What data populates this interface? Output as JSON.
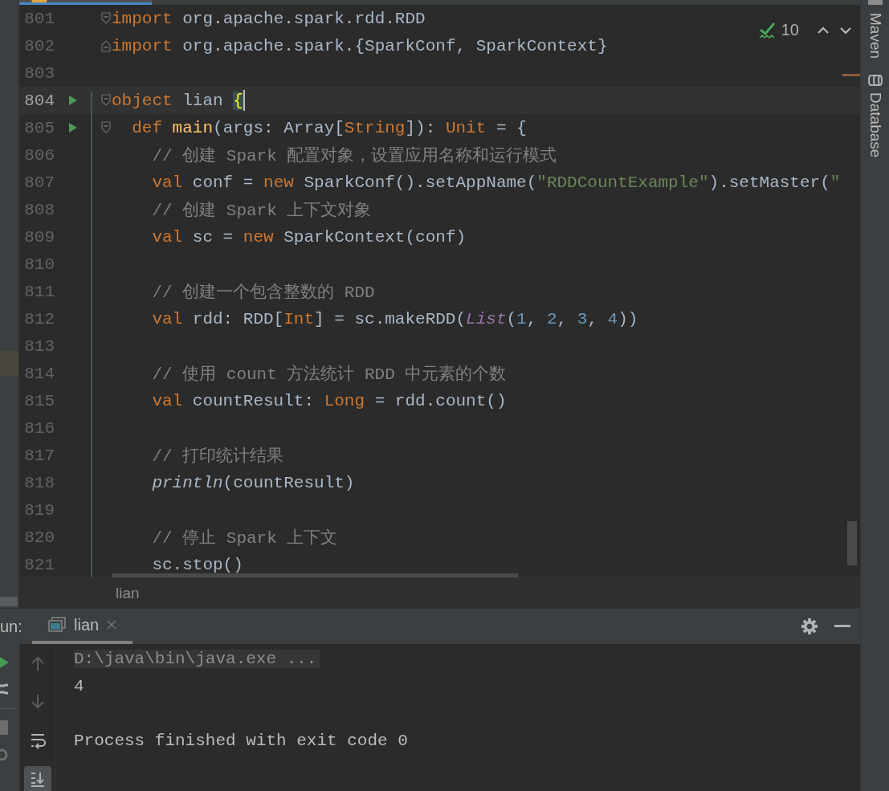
{
  "editor": {
    "inspection": {
      "count": "10"
    },
    "lines": [
      {
        "number": "801",
        "kind": "fold-start",
        "run": false,
        "current": false,
        "tokens": [
          {
            "kind": "keyword",
            "text": "import"
          },
          {
            "kind": "plain",
            "text": " org.apache.spark.rdd.RDD"
          }
        ]
      },
      {
        "number": "802",
        "kind": "fold-end",
        "run": false,
        "current": false,
        "tokens": [
          {
            "kind": "keyword",
            "text": "import"
          },
          {
            "kind": "plain",
            "text": " org.apache.spark.{SparkConf, SparkContext}"
          }
        ]
      },
      {
        "number": "803",
        "run": false,
        "current": false
      },
      {
        "number": "804",
        "kind": "fold-start",
        "run": true,
        "current": true,
        "tokens": [
          {
            "kind": "keyword",
            "text": "object"
          },
          {
            "kind": "plain",
            "text": " lian "
          },
          {
            "kind": "brace-match",
            "text": "{"
          }
        ],
        "children": [
          {
            "number": "805",
            "kind": "fold-start",
            "run": true,
            "current": false,
            "tokens": [
              {
                "kind": "keyword",
                "text": "def "
              },
              {
                "kind": "function",
                "text": "main"
              },
              {
                "kind": "plain",
                "text": "(args: Array["
              },
              {
                "kind": "keyword",
                "text": "String"
              },
              {
                "kind": "plain",
                "text": "]): "
              },
              {
                "kind": "keyword",
                "text": "Unit"
              },
              {
                "kind": "plain",
                "text": " = {"
              }
            ],
            "children": [
              {
                "number": "806",
                "run": false,
                "current": false,
                "tokens": [
                  {
                    "kind": "comment",
                    "text": "// 创建 Spark 配置对象，设置应用名称和运行模式"
                  }
                ]
              },
              {
                "number": "807",
                "run": false,
                "current": false,
                "tokens": [
                  {
                    "kind": "keyword",
                    "text": "val"
                  },
                  {
                    "kind": "plain",
                    "text": " conf = "
                  },
                  {
                    "kind": "keyword",
                    "text": "new"
                  },
                  {
                    "kind": "plain",
                    "text": " SparkConf().setAppName("
                  },
                  {
                    "kind": "string",
                    "text": "\"RDDCountExample\""
                  },
                  {
                    "kind": "plain",
                    "text": ").setMaster("
                  },
                  {
                    "kind": "string",
                    "text": "\""
                  }
                ]
              },
              {
                "number": "808",
                "run": false,
                "current": false,
                "tokens": [
                  {
                    "kind": "comment",
                    "text": "// 创建 Spark 上下文对象"
                  }
                ]
              },
              {
                "number": "809",
                "run": false,
                "current": false,
                "tokens": [
                  {
                    "kind": "keyword",
                    "text": "val"
                  },
                  {
                    "kind": "plain",
                    "text": " sc = "
                  },
                  {
                    "kind": "keyword",
                    "text": "new"
                  },
                  {
                    "kind": "plain",
                    "text": " SparkContext(conf)"
                  }
                ]
              },
              {
                "number": "810",
                "run": false,
                "current": false
              },
              {
                "number": "811",
                "run": false,
                "current": false,
                "tokens": [
                  {
                    "kind": "comment",
                    "text": "// 创建一个包含整数的 RDD"
                  }
                ]
              },
              {
                "number": "812",
                "run": false,
                "current": false,
                "tokens": [
                  {
                    "kind": "keyword",
                    "text": "val"
                  },
                  {
                    "kind": "plain",
                    "text": " rdd: RDD["
                  },
                  {
                    "kind": "keyword",
                    "text": "Int"
                  },
                  {
                    "kind": "plain",
                    "text": "] = sc.makeRDD("
                  },
                  {
                    "kind": "object",
                    "text": "List"
                  },
                  {
                    "kind": "plain",
                    "text": "("
                  },
                  {
                    "kind": "number",
                    "text": "1"
                  },
                  {
                    "kind": "plain",
                    "text": ", "
                  },
                  {
                    "kind": "number",
                    "text": "2"
                  },
                  {
                    "kind": "plain",
                    "text": ", "
                  },
                  {
                    "kind": "number",
                    "text": "3"
                  },
                  {
                    "kind": "plain",
                    "text": ", "
                  },
                  {
                    "kind": "number",
                    "text": "4"
                  },
                  {
                    "kind": "plain",
                    "text": "))"
                  }
                ]
              },
              {
                "number": "813",
                "run": false,
                "current": false
              },
              {
                "number": "814",
                "run": false,
                "current": false,
                "tokens": [
                  {
                    "kind": "comment",
                    "text": "// 使用 count 方法统计 RDD 中元素的个数"
                  }
                ]
              },
              {
                "number": "815",
                "run": false,
                "current": false,
                "tokens": [
                  {
                    "kind": "keyword",
                    "text": "val"
                  },
                  {
                    "kind": "plain",
                    "text": " countResult: "
                  },
                  {
                    "kind": "keyword",
                    "text": "Long"
                  },
                  {
                    "kind": "plain",
                    "text": " = rdd.count()"
                  }
                ]
              },
              {
                "number": "816",
                "run": false,
                "current": false
              },
              {
                "number": "817",
                "run": false,
                "current": false,
                "tokens": [
                  {
                    "kind": "comment",
                    "text": "// 打印统计结果"
                  }
                ]
              },
              {
                "number": "818",
                "run": false,
                "current": false,
                "tokens": [
                  {
                    "kind": "italic",
                    "text": "println"
                  },
                  {
                    "kind": "plain",
                    "text": "(countResult)"
                  }
                ]
              },
              {
                "number": "819",
                "run": false,
                "current": false
              },
              {
                "number": "820",
                "run": false,
                "current": false,
                "tokens": [
                  {
                    "kind": "comment",
                    "text": "// 停止 Spark 上下文"
                  }
                ]
              },
              {
                "number": "821",
                "run": false,
                "current": false,
                "tokens": [
                  {
                    "kind": "plain",
                    "text": "sc.stop()"
                  }
                ]
              }
            ]
          }
        ]
      }
    ],
    "breadcrumb": [
      "lian"
    ]
  },
  "run_panel": {
    "label": "un:",
    "tabs": [
      {
        "label": "lian",
        "selected": true
      }
    ],
    "toolbar": [
      {
        "kind": "up",
        "disabled": true,
        "on": false
      },
      {
        "kind": "down",
        "disabled": true,
        "on": false
      },
      {
        "kind": "wrap",
        "disabled": false,
        "on": false
      },
      {
        "kind": "scroll-end",
        "disabled": false,
        "on": true
      }
    ],
    "console": [
      {
        "kind": "command",
        "text": "D:\\java\\bin\\java.exe ..."
      },
      {
        "kind": "output",
        "text": "4"
      },
      {
        "kind": "blank"
      },
      {
        "kind": "output",
        "text": "Process finished with exit code 0"
      }
    ]
  },
  "tool_windows": [
    {
      "kind": "maven",
      "label": "Maven"
    },
    {
      "kind": "database",
      "label": "Database"
    }
  ]
}
